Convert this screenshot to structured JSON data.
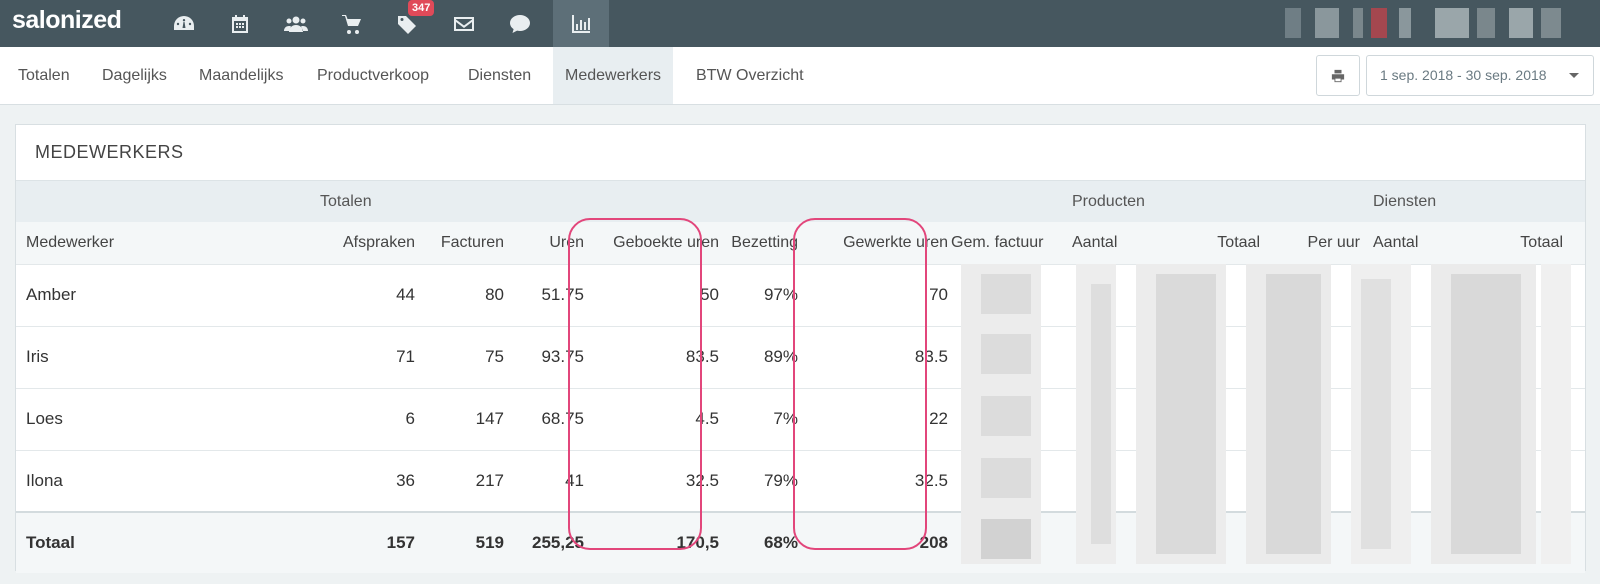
{
  "app": {
    "name": "salonized"
  },
  "topnav": {
    "icons": [
      "dashboard-icon",
      "calendar-icon",
      "customers-icon",
      "cart-icon",
      "tags-icon",
      "mail-icon",
      "chat-icon",
      "reports-icon"
    ],
    "badge": "347"
  },
  "subnav": {
    "tabs": [
      "Totalen",
      "Dagelijks",
      "Maandelijks",
      "Productverkoop",
      "Diensten",
      "Medewerkers",
      "BTW Overzicht"
    ],
    "active_tab": "Medewerkers",
    "date_range": "1 sep. 2018 - 30 sep. 2018"
  },
  "report": {
    "title": "MEDEWERKERS",
    "groups": {
      "totalen": "Totalen",
      "producten": "Producten",
      "diensten": "Diensten"
    },
    "columns": [
      "Medewerker",
      "Afspraken",
      "Facturen",
      "Uren",
      "Geboekte uren",
      "Bezetting",
      "Gewerkte uren",
      "Gem. factuur",
      "Aantal",
      "Totaal",
      "Per uur",
      "Aantal",
      "Totaal"
    ],
    "rows": [
      {
        "name": "Amber",
        "afspraken": "44",
        "facturen": "80",
        "uren": "51.75",
        "geboekte_uren": "50",
        "bezetting": "97%",
        "gewerkte_uren": "70"
      },
      {
        "name": "Iris",
        "afspraken": "71",
        "facturen": "75",
        "uren": "93.75",
        "geboekte_uren": "83.5",
        "bezetting": "89%",
        "gewerkte_uren": "83.5"
      },
      {
        "name": "Loes",
        "afspraken": "6",
        "facturen": "147",
        "uren": "68.75",
        "geboekte_uren": "4.5",
        "bezetting": "7%",
        "gewerkte_uren": "22"
      },
      {
        "name": "Ilona",
        "afspraken": "36",
        "facturen": "217",
        "uren": "41",
        "geboekte_uren": "32.5",
        "bezetting": "79%",
        "gewerkte_uren": "32.5"
      }
    ],
    "total": {
      "name": "Totaal",
      "afspraken": "157",
      "facturen": "519",
      "uren": "255,25",
      "geboekte_uren": "170,5",
      "bezetting": "68%",
      "gewerkte_uren": "208"
    }
  },
  "colors": {
    "topbar": "#46575f",
    "highlight": "#e2467b",
    "badge": "#e04a59"
  }
}
